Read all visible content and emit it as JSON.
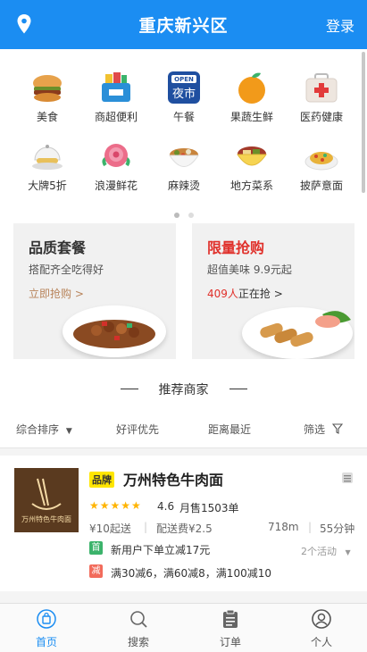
{
  "header": {
    "title": "重庆新兴区",
    "login": "登录",
    "location_icon": "map-pin-icon"
  },
  "categories": [
    {
      "label": "美食",
      "icon": "burger-icon",
      "color": "#e09a3a"
    },
    {
      "label": "商超便利",
      "icon": "shopping-basket-icon",
      "color": "#2b8fd8"
    },
    {
      "label": "午餐",
      "icon": "open-night-market-icon",
      "color": "#1f4fa0"
    },
    {
      "label": "果蔬生鲜",
      "icon": "orange-icon",
      "color": "#f29a1a"
    },
    {
      "label": "医药健康",
      "icon": "medicine-box-icon",
      "color": "#e9e2dc"
    },
    {
      "label": "大牌5折",
      "icon": "dish-cloche-icon",
      "color": "#e8c05a"
    },
    {
      "label": "浪漫鲜花",
      "icon": "rose-icon",
      "color": "#ec6d8a"
    },
    {
      "label": "麻辣烫",
      "icon": "spicy-bowl-icon",
      "color": "#c8843c"
    },
    {
      "label": "地方菜系",
      "icon": "local-dish-icon",
      "color": "#d6a62f"
    },
    {
      "label": "披萨意面",
      "icon": "pasta-icon",
      "color": "#e8b23a"
    }
  ],
  "promos": {
    "quality": {
      "title": "品质套餐",
      "subtitle": "搭配齐全吃得好",
      "link": "立即抢购 >"
    },
    "flash": {
      "title": "限量抢购",
      "subtitle": "超值美味 9.9元起",
      "count": "409人",
      "link": "正在抢 >"
    }
  },
  "recommend": {
    "title": "推荐商家"
  },
  "sort": {
    "default": "综合排序",
    "good": "好评优先",
    "near": "距离最近",
    "filter": "筛选"
  },
  "shop": {
    "badge": "品牌",
    "name": "万州特色牛肉面",
    "logo_text": "万州特色牛肉面",
    "rating": "4.6",
    "stars": "★★★★★",
    "monthly_sales": "月售1503单",
    "min_order": "¥10起送",
    "delivery_fee": "配送费¥2.5",
    "distance": "718m",
    "time": "55分钟",
    "first_tag": "首",
    "first_text": "新用户下单立减17元",
    "activities": "2个活动",
    "reduce_tag": "减",
    "reduce_text": "满30减6，满60减8，满100减10"
  },
  "tabs": [
    {
      "label": "首页",
      "icon": "home-bag-icon"
    },
    {
      "label": "搜索",
      "icon": "search-icon"
    },
    {
      "label": "订单",
      "icon": "order-list-icon"
    },
    {
      "label": "个人",
      "icon": "user-icon"
    }
  ],
  "colors": {
    "accent": "#1b8df2",
    "red": "#e0302a",
    "gold": "#ffb400"
  }
}
